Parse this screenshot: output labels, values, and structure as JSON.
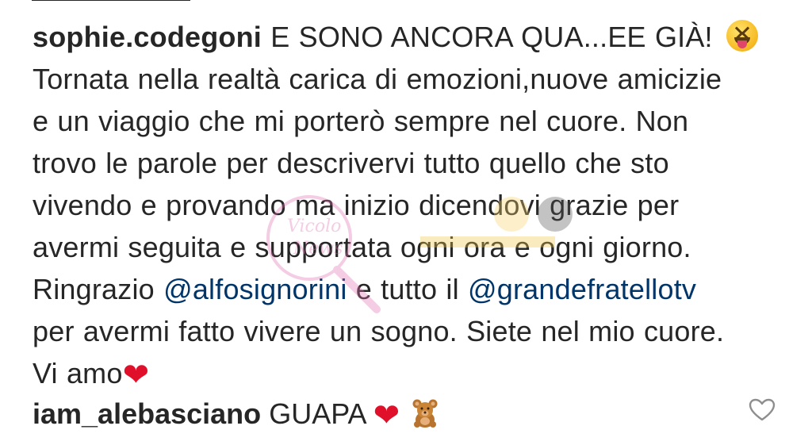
{
  "post": {
    "username": "sophie.codegoni",
    "caption_lines": [
      "E SONO ANCORA QUA...EE GIÀ!",
      "Tornata nella realtà carica di emozioni,nuove amicizie",
      "e un viaggio che mi porterò sempre nel cuore. Non",
      "trovo le parole per descrivervi tutto quello che sto",
      "vivendo e provando ma inizio dicendovi grazie per",
      "avermi seguita e supportata ogni ora e ogni giorno.",
      "Ringrazio",
      "e tutto il",
      "per avermi fatto vivere un sogno. Siete nel mio cuore.",
      "Vi amo"
    ],
    "mentions": [
      "@alfosignorini",
      "@grandefratellotv"
    ],
    "emojis": {
      "line1_end": "squinting-face-with-tongue-emoji",
      "caption_end": "red-heart-emoji"
    }
  },
  "comment": {
    "username": "iam_alebasciano",
    "text": "GUAPA",
    "emojis": [
      "red-heart-emoji",
      "teddy-bear-emoji"
    ]
  },
  "icons": {
    "like": "heart-outline-icon"
  },
  "colors": {
    "text": "#262626",
    "mention": "#003569",
    "heart": "#e0102a",
    "watermark": "#e8a0c8"
  }
}
